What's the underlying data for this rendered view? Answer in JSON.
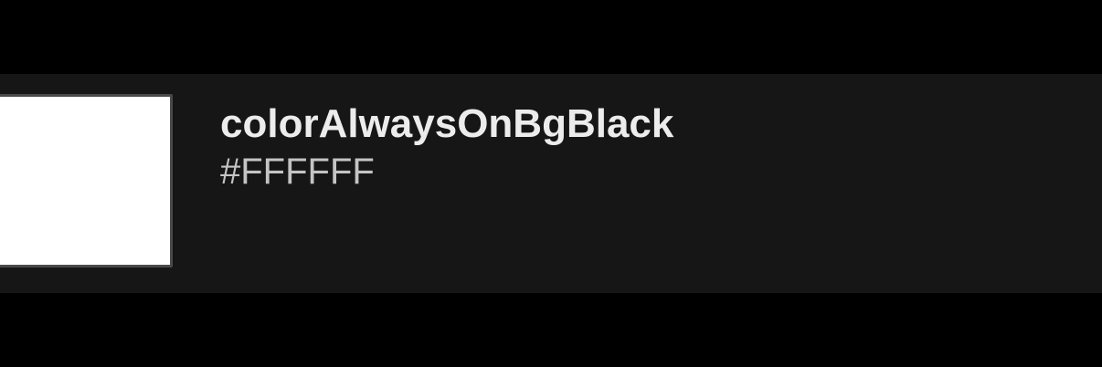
{
  "colors": {
    "page_background": "#000000",
    "row_background": "#161616",
    "swatch_border": "#4A4A4A",
    "name_text": "#ECECEC",
    "value_text": "#C4C4C4"
  },
  "color_item": {
    "name": "colorAlwaysOnBgBlack",
    "hex": "#FFFFFF",
    "swatch_color": "#FFFFFF"
  }
}
